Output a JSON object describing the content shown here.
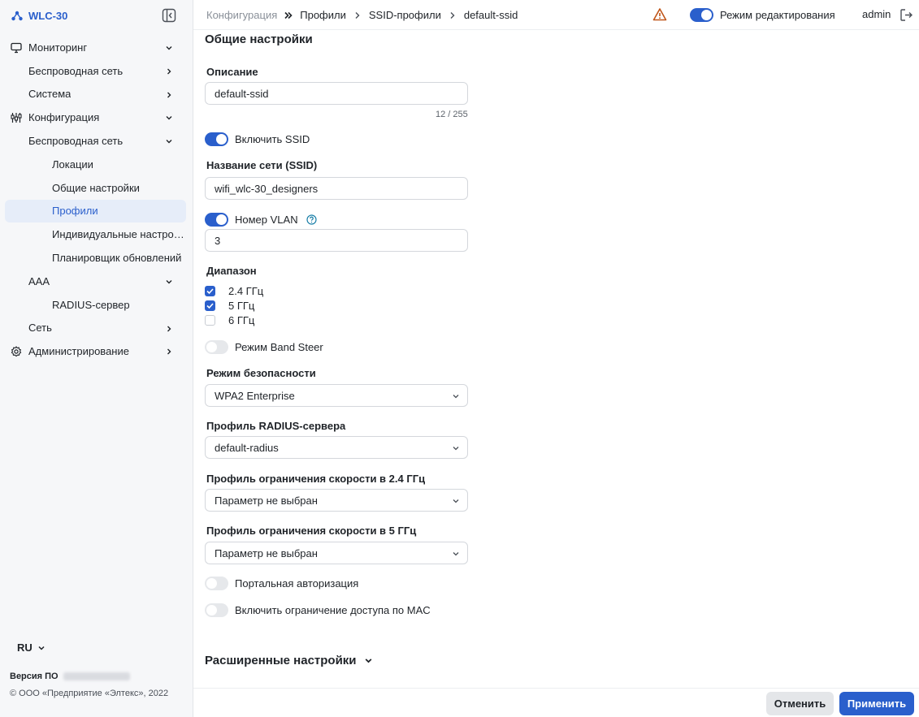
{
  "app": {
    "title": "WLC-30"
  },
  "sidebar": {
    "items": [
      {
        "label": "Мониторинг",
        "level": 0,
        "icon": "monitor-icon",
        "chevron": "down"
      },
      {
        "label": "Беспроводная сеть",
        "level": 1,
        "chevron": "right"
      },
      {
        "label": "Система",
        "level": 1,
        "chevron": "right"
      },
      {
        "label": "Конфигурация",
        "level": 0,
        "icon": "sliders-icon",
        "chevron": "down"
      },
      {
        "label": "Беспроводная сеть",
        "level": 1,
        "chevron": "down"
      },
      {
        "label": "Локации",
        "level": 2
      },
      {
        "label": "Общие настройки",
        "level": 2
      },
      {
        "label": "Профили",
        "level": 2,
        "active": true
      },
      {
        "label": "Индивидуальные настройки",
        "level": 2
      },
      {
        "label": "Планировщик обновлений",
        "level": 2
      },
      {
        "label": "AAA",
        "level": 1,
        "chevron": "down"
      },
      {
        "label": "RADIUS-сервер",
        "level": 2
      },
      {
        "label": "Сеть",
        "level": 1,
        "chevron": "right"
      },
      {
        "label": "Администрирование",
        "level": 0,
        "icon": "gear-icon",
        "chevron": "right"
      }
    ],
    "lang": "RU",
    "version_label": "Версия ПО",
    "copyright": "© ООО «Предприятие «Элтекс», 2022"
  },
  "header": {
    "breadcrumbs": [
      "Конфигурация",
      "Профили",
      "SSID-профили",
      "default-ssid"
    ],
    "edit_mode_label": "Режим редактирования",
    "edit_mode_on": true,
    "user": "admin"
  },
  "form": {
    "section_title": "Общие настройки",
    "description_label": "Описание",
    "description_value": "default-ssid",
    "description_counter": "12 / 255",
    "enable_ssid_label": "Включить SSID",
    "enable_ssid_on": true,
    "ssid_name_label": "Название сети (SSID)",
    "ssid_name_value": "wifi_wlc-30_designers",
    "vlan_label": "Номер VLAN",
    "vlan_on": true,
    "vlan_value": "3",
    "band_label": "Диапазон",
    "bands": [
      {
        "label": "2.4 ГГц",
        "checked": true
      },
      {
        "label": "5 ГГц",
        "checked": true
      },
      {
        "label": "6 ГГц",
        "checked": false
      }
    ],
    "band_steer_label": "Режим Band Steer",
    "band_steer_on": false,
    "security_label": "Режим безопасности",
    "security_value": "WPA2 Enterprise",
    "radius_label": "Профиль RADIUS-сервера",
    "radius_value": "default-radius",
    "rate24_label": "Профиль ограничения скорости в 2.4 ГГц",
    "rate24_value": "Параметр не выбран",
    "rate5_label": "Профиль ограничения скорости в 5 ГГц",
    "rate5_value": "Параметр не выбран",
    "portal_label": "Портальная авторизация",
    "portal_on": false,
    "mac_label": "Включить ограничение доступа по MAC",
    "mac_on": false,
    "advanced_label": "Расширенные настройки"
  },
  "footer": {
    "cancel_label": "Отменить",
    "apply_label": "Применить"
  },
  "colors": {
    "accent": "#2a5fcc",
    "warning": "#c0561a",
    "active_bg": "#e6edf9"
  }
}
